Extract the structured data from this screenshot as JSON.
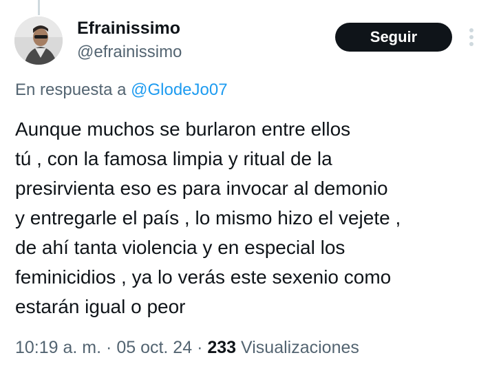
{
  "author": {
    "display_name": "Efrainissimo",
    "handle": "@efrainissimo"
  },
  "actions": {
    "follow_label": "Seguir",
    "more_icon": "more-vertical-icon"
  },
  "reply": {
    "prefix": "En respuesta a",
    "mention": "@GlodeJo07"
  },
  "tweet": {
    "lines": [
      "Aunque muchos se burlaron entre ellos",
      "tú , con la famosa limpia y ritual de la",
      "presirvienta eso es para invocar al demonio",
      "y entregarle el país , lo mismo hizo el vejete ,",
      "de ahí tanta violencia y en especial los",
      "feminicidios , ya lo verás este sexenio como",
      "estarán igual o peor"
    ]
  },
  "meta": {
    "time": "10:19 a. m.",
    "separator": "·",
    "date": "05 oct. 24",
    "views_count": "233",
    "views_label": "Visualizaciones"
  },
  "colors": {
    "text": "#0f1419",
    "secondary": "#536471",
    "link": "#1d9bf0",
    "button_bg": "#0f1419",
    "button_text": "#ffffff"
  }
}
